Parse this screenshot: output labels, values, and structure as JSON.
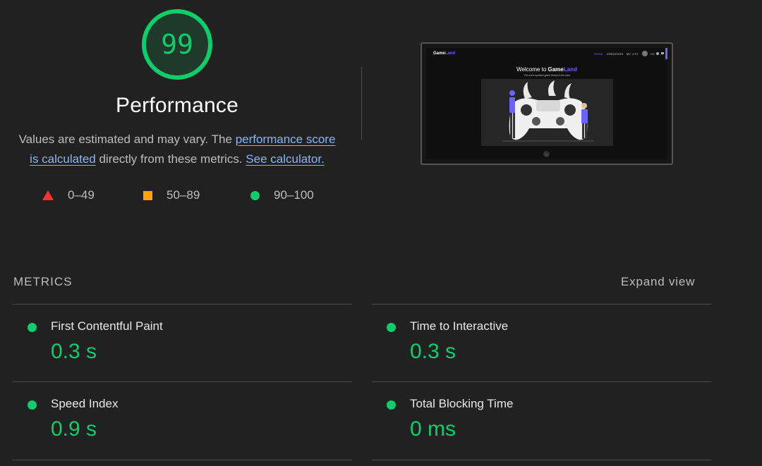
{
  "score": {
    "value": "99",
    "fraction": 0.99,
    "color": "#0cce6b",
    "title": "Performance"
  },
  "description": {
    "text_1": "Values are estimated and may vary. The ",
    "link_1": "performance score is calculated",
    "text_2": " directly from these metrics. ",
    "link_2": "See calculator."
  },
  "legend": [
    {
      "range": "0–49",
      "shape": "triangle",
      "color": "#ff3333"
    },
    {
      "range": "50–89",
      "shape": "square",
      "color": "#ffa400"
    },
    {
      "range": "90–100",
      "shape": "circle",
      "color": "#0cce6b"
    }
  ],
  "screenshot": {
    "logo_main": "Game",
    "logo_accent": "Land",
    "nav": [
      "HOME",
      "CREATORS",
      "MY LIST"
    ],
    "avatar_label": "CC",
    "heading_prefix": "Welcome to ",
    "heading_brand": "Game",
    "heading_accent": "Land",
    "subheading": "The most updated game library in the web",
    "chevron": "⌄"
  },
  "metrics": {
    "label": "METRICS",
    "expand_label": "Expand view",
    "items": [
      {
        "name": "First Contentful Paint",
        "value": "0.3 s"
      },
      {
        "name": "Time to Interactive",
        "value": "0.3 s"
      },
      {
        "name": "Speed Index",
        "value": "0.9 s"
      },
      {
        "name": "Total Blocking Time",
        "value": "0 ms"
      }
    ]
  }
}
